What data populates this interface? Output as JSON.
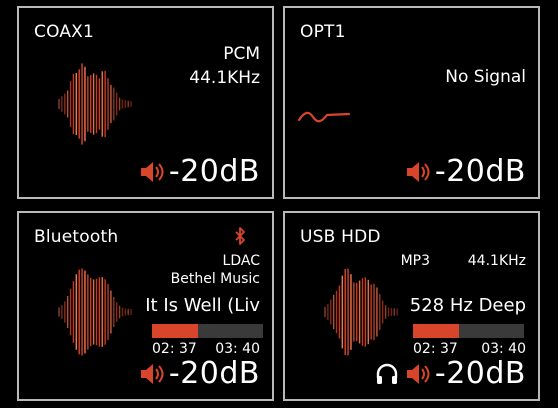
{
  "panels": {
    "coax": {
      "source": "COAX1",
      "format": "PCM",
      "rate": "44.1KHz",
      "volume": "-20dB"
    },
    "opt": {
      "source": "OPT1",
      "status": "No Signal",
      "volume": "-20dB"
    },
    "bt": {
      "source": "Bluetooth",
      "codec": "LDAC",
      "artist": "Bethel Music",
      "title": "It Is Well (Liv",
      "elapsed": "02: 37",
      "total": "03: 40",
      "progress": 0.41,
      "volume": "-20dB"
    },
    "usb": {
      "source": "USB HDD",
      "format": "MP3",
      "rate": "44.1KHz",
      "title": "528 Hz Deep",
      "elapsed": "02: 37",
      "total": "03: 40",
      "progress": 0.41,
      "volume": "-20dB"
    }
  },
  "colors": {
    "accent": "#d9452a",
    "border": "#b9b9b9",
    "track": "#3a3a3a"
  },
  "icons": [
    "speaker-icon",
    "bluetooth-icon",
    "headphones-icon",
    "waveform-icon",
    "squiggle-icon"
  ]
}
